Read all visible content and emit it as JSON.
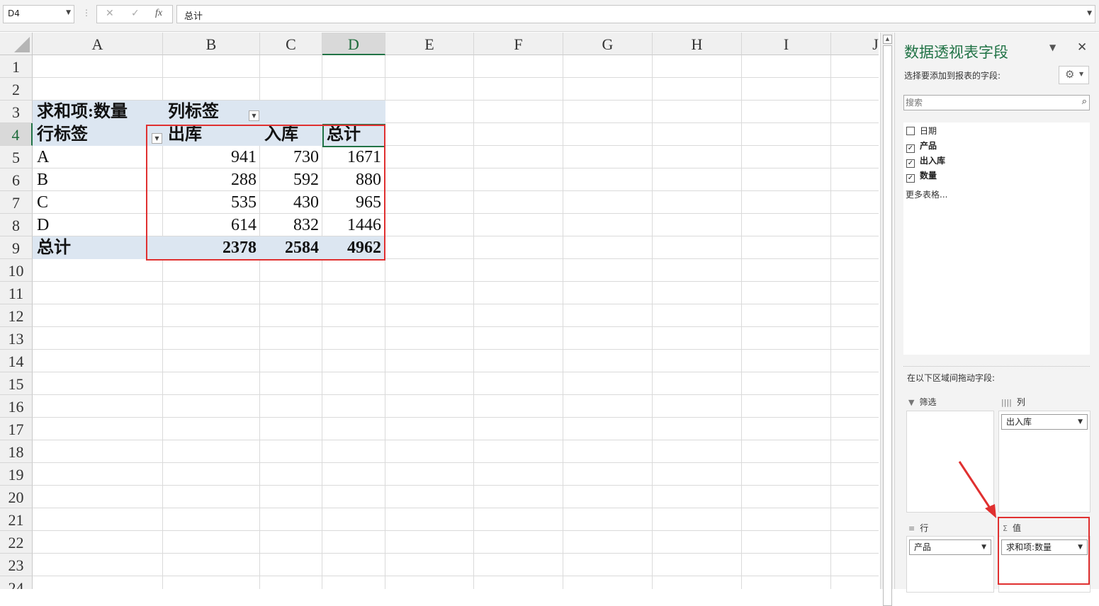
{
  "formula_bar": {
    "name_box": "D4",
    "cancel_glyph": "✕",
    "enter_glyph": "✓",
    "fx_glyph": "fx",
    "content": "总计"
  },
  "sheet": {
    "active_cell": "D4",
    "columns": [
      "A",
      "B",
      "C",
      "D",
      "E",
      "F",
      "G",
      "H",
      "I",
      "J"
    ],
    "rows": [
      "1",
      "2",
      "3",
      "4",
      "5",
      "6",
      "7",
      "8",
      "9",
      "10",
      "11",
      "12",
      "13",
      "14",
      "15",
      "16",
      "17",
      "18",
      "19",
      "20",
      "21",
      "22",
      "23",
      "24"
    ],
    "pivot": {
      "value_header": "求和项:数量",
      "col_label_header": "列标签",
      "row_label_header": "行标签",
      "col_headers": [
        "出库",
        "入库",
        "总计"
      ],
      "rows": [
        {
          "label": "A",
          "values": [
            "941",
            "730",
            "1671"
          ]
        },
        {
          "label": "B",
          "values": [
            "288",
            "592",
            "880"
          ]
        },
        {
          "label": "C",
          "values": [
            "535",
            "430",
            "965"
          ]
        },
        {
          "label": "D",
          "values": [
            "614",
            "832",
            "1446"
          ]
        }
      ],
      "total": {
        "label": "总计",
        "values": [
          "2378",
          "2584",
          "4962"
        ]
      }
    }
  },
  "pivot_pane": {
    "title": "数据透视表字段",
    "subtitle": "选择要添加到报表的字段:",
    "search_placeholder": "搜索",
    "fields": [
      {
        "name": "日期",
        "checked": false
      },
      {
        "name": "产品",
        "checked": true
      },
      {
        "name": "出入库",
        "checked": true
      },
      {
        "name": "数量",
        "checked": true
      }
    ],
    "more_tables": "更多表格...",
    "drag_hint": "在以下区域间拖动字段:",
    "areas": {
      "filter": {
        "label": "筛选",
        "icon": "filter-icon",
        "items": []
      },
      "columns": {
        "label": "列",
        "icon": "columns-icon",
        "items": [
          "出入库"
        ]
      },
      "rows": {
        "label": "行",
        "icon": "rows-icon",
        "items": [
          "产品"
        ]
      },
      "values": {
        "label": "值",
        "icon": "sigma-icon",
        "items": [
          "求和项:数量"
        ]
      }
    }
  },
  "colors": {
    "accent_green": "#217346",
    "pivot_band": "#dce6f1",
    "highlight_red": "#e03030"
  }
}
